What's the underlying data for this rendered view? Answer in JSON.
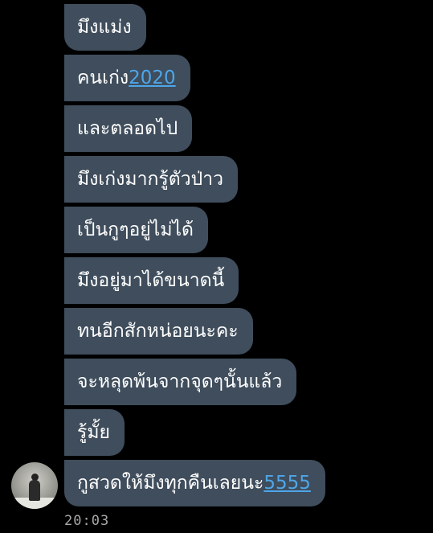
{
  "messages": [
    {
      "text": "มึงแม่ง",
      "link": ""
    },
    {
      "text": "คนเก่ง",
      "link": "2020"
    },
    {
      "text": "และตลอดไป",
      "link": ""
    },
    {
      "text": "มึงเก่งมากรู้ตัวป่าว",
      "link": ""
    },
    {
      "text": "เป็นกูๆอยู่ไม่ได้",
      "link": ""
    },
    {
      "text": "มึงอยู่มาได้ขนาดนี้",
      "link": ""
    },
    {
      "text": "ทนอีกสักหน่อยนะคะ",
      "link": ""
    },
    {
      "text": "จะหลุดพ้นจากจุดๆนั้นแล้ว",
      "link": ""
    },
    {
      "text": "รู้มั้ย",
      "link": ""
    },
    {
      "text": "กูสวดให้มึงทุกคืนเลยนะ",
      "link": "5555"
    }
  ],
  "timestamp": "20:03",
  "colors": {
    "background": "#000000",
    "bubble": "#3f4d5c",
    "text": "#ffffff",
    "link": "#4ea6e8",
    "timestamp": "#a8a8a8"
  }
}
